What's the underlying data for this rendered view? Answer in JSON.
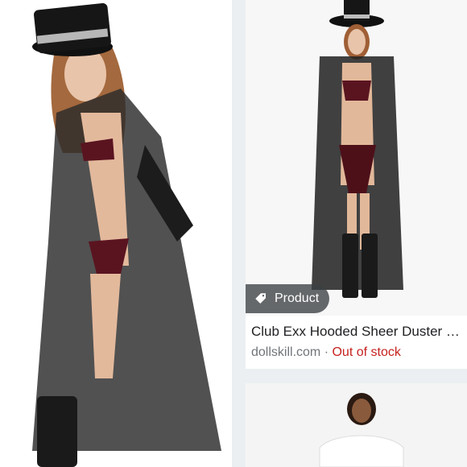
{
  "result": {
    "chip_label": "Product",
    "chip_icon": "tag-icon",
    "title": "Club Exx Hooded Sheer Duster B...",
    "source": "dollskill.com",
    "separator": "·",
    "availability": "Out of stock",
    "colors": {
      "availability": "#c5221f",
      "chip_bg": "#3c4043"
    }
  }
}
